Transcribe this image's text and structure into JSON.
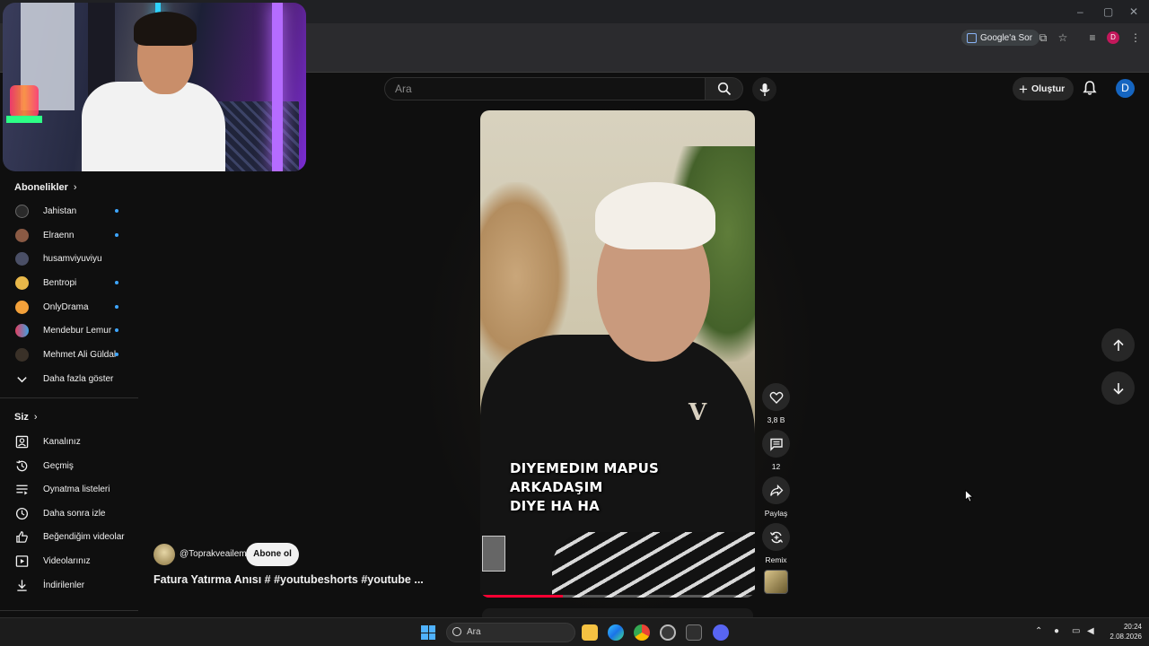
{
  "browser": {
    "ask_google_label": "Google'a Sor",
    "profile_initial": "D"
  },
  "header": {
    "search_placeholder": "Ara",
    "create_label": "Oluştur",
    "avatar_initial": "D"
  },
  "sidebar": {
    "subscriptions_title": "Abonelikler",
    "channels": [
      {
        "label": "Jahistan",
        "live": true
      },
      {
        "label": "Elraenn",
        "live": true
      },
      {
        "label": "husamviyuviyu",
        "live": false
      },
      {
        "label": "Bentropi",
        "live": true
      },
      {
        "label": "OnlyDrama",
        "live": true
      },
      {
        "label": "Mendebur Lemur",
        "live": true
      },
      {
        "label": "Mehmet Ali Güldal",
        "live": true
      }
    ],
    "show_more_label": "Daha fazla göster",
    "you_title": "Siz",
    "you_items": [
      {
        "label": "Kanalınız",
        "icon": "account-box-icon"
      },
      {
        "label": "Geçmiş",
        "icon": "history-icon"
      },
      {
        "label": "Oynatma listeleri",
        "icon": "playlist-icon"
      },
      {
        "label": "Daha sonra izle",
        "icon": "clock-icon"
      },
      {
        "label": "Beğendiğim videolar",
        "icon": "thumbs-up-icon"
      },
      {
        "label": "Videolarınız",
        "icon": "play-box-icon"
      },
      {
        "label": "İndirilenler",
        "icon": "download-icon"
      }
    ]
  },
  "short": {
    "subtitle_line1": "DIYEMEDIM MAPUS ARKADAŞIM",
    "subtitle_line2": "DIYE HA HA",
    "channel_handle": "@Toprakveailem",
    "subscribe_label": "Abone ol",
    "title": "Fatura Yatırma Anısı # #youtubeshorts #youtube ...",
    "progress": 0.3
  },
  "actions": {
    "like_count": "3,8 B",
    "comment_count": "12",
    "share_label": "Paylaş",
    "remix_label": "Remix"
  },
  "taskbar": {
    "search_label": "Ara",
    "time": "20:24",
    "date": "2.08.2026"
  },
  "colors": {
    "background": "#0f0f0f",
    "accent_blue": "#3ea6ff",
    "youtube_red": "#ff0033"
  }
}
